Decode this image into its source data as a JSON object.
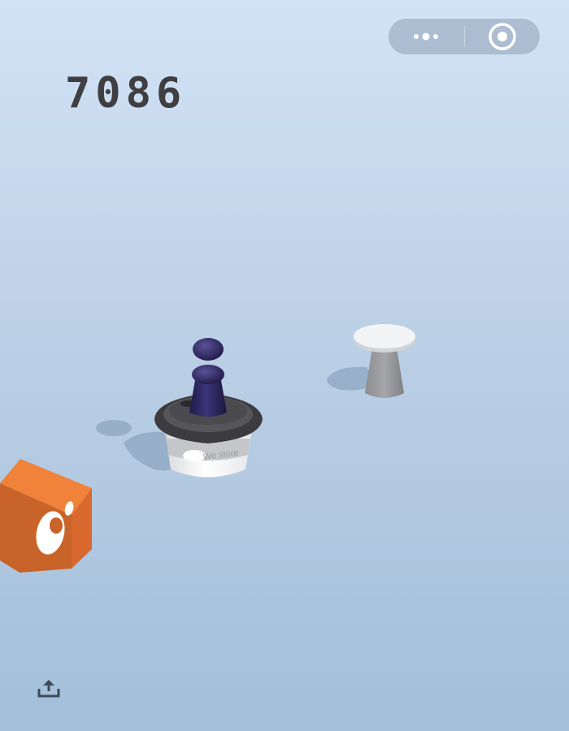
{
  "capsule": {
    "more_icon": "more-dots-icon",
    "close_icon": "target-circle-icon"
  },
  "score": "7086",
  "scene": {
    "cup_label": "We store",
    "player_color": "#2e2860",
    "cup_lid_color": "#4e4e52",
    "orange_block_color": "#f0823a",
    "stool_color": "#e6e8ea"
  },
  "share_icon": "share-upload-icon"
}
